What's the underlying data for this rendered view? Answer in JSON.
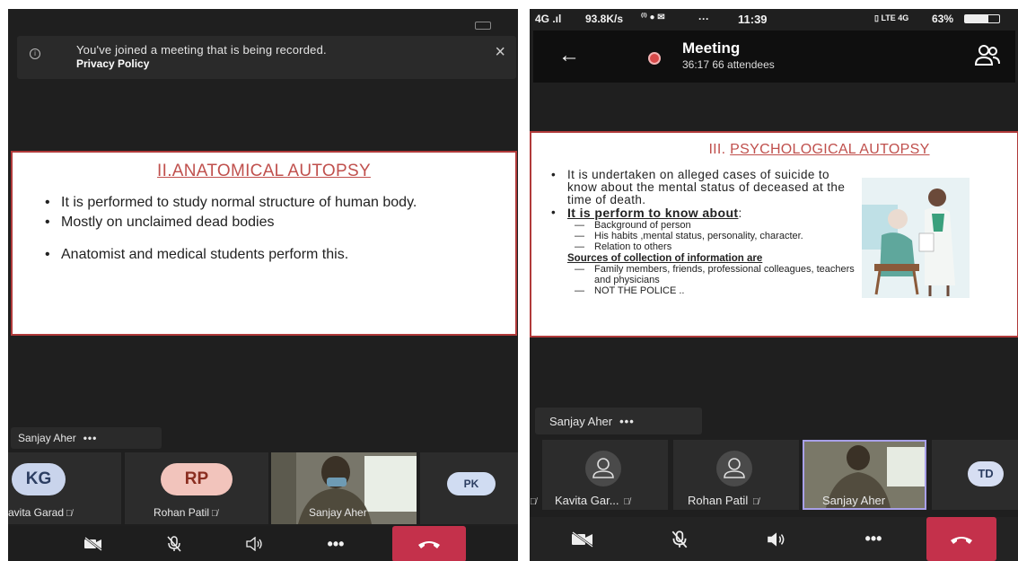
{
  "left": {
    "banner": {
      "message": "You've joined a meeting that is being recorded.",
      "policy_link": "Privacy Policy",
      "close_glyph": "×",
      "info_glyph": "i"
    },
    "slide": {
      "title": "II.ANATOMICAL AUTOPSY",
      "bullets": [
        "It is performed to study normal structure of human body.",
        "Mostly on unclaimed dead bodies",
        "Anatomist and medical students perform this."
      ]
    },
    "speaker": {
      "name": "Sanjay Aher",
      "more": "•••"
    },
    "participants": [
      {
        "initials": "KG",
        "name": "avita Garad"
      },
      {
        "initials": "RP",
        "name": "Rohan Patil"
      },
      {
        "initials": "",
        "name": "Sanjay Aher"
      },
      {
        "initials": "PK",
        "name": ""
      }
    ],
    "controls": {
      "more": "•••"
    }
  },
  "right": {
    "status_bar": {
      "network": "4G .ıl",
      "speed": "93.8K/s",
      "time": "11:39",
      "battery": "63%",
      "more": "···"
    },
    "header": {
      "title": "Meeting",
      "subtitle": "36:17  66 attendees",
      "back_glyph": "←"
    },
    "slide": {
      "title_prefix": "III. ",
      "title_main": "PSYCHOLOGICAL AUTOPSY",
      "bullet1": "It is undertaken on alleged cases of suicide to know about the mental status of deceased at the time of death.",
      "bullet2_head": "It is perform to know about",
      "bullet2_colon": ":",
      "items": [
        "Background of person",
        "His habits ,mental status, personality, character.",
        "Relation to others"
      ],
      "sources_head": "Sources of collection of information are",
      "sources": [
        "Family members, friends, professional colleagues, teachers and physicians",
        "NOT THE POLICE .."
      ]
    },
    "speaker": {
      "name": "Sanjay Aher",
      "more": "•••"
    },
    "participants": [
      {
        "name": "Kavita Gar..."
      },
      {
        "name": "Rohan Patil"
      },
      {
        "name": "Sanjay Aher"
      },
      {
        "initials": "TD"
      }
    ],
    "controls": {
      "more": "•••"
    }
  },
  "colors": {
    "slide_title": "#c0504d",
    "slide_border": "#b03a3a",
    "hangup": "#c4314b",
    "background": "#1f1f1f"
  }
}
